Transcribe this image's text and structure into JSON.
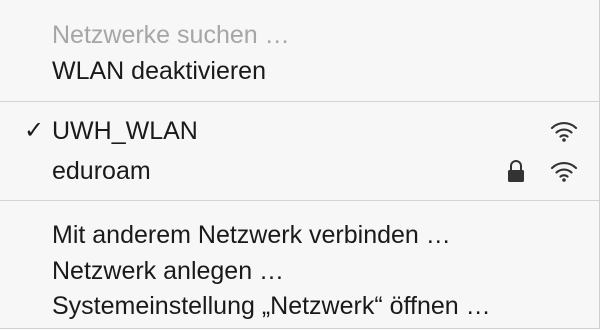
{
  "menu": {
    "search_label": "Netzwerke suchen …",
    "disable_wifi_label": "WLAN deaktivieren",
    "networks": [
      {
        "name": "UWH_WLAN",
        "selected": true,
        "check": "✓",
        "secured": false,
        "icon": "wifi-icon"
      },
      {
        "name": "eduroam",
        "selected": false,
        "secured": true,
        "icon": "wifi-icon",
        "lock_icon": "lock-icon"
      }
    ],
    "other_network_label": "Mit anderem Netzwerk verbinden …",
    "create_network_label": "Netzwerk anlegen …",
    "open_prefs_label": "Systemeinstellung „Netzwerk“ öffnen …"
  },
  "colors": {
    "menu_background": "#f7f7f7",
    "text": "#1a1a1a",
    "disabled_text": "#a6a6a6",
    "separator": "#d4d4d4",
    "icon": "#333333"
  }
}
